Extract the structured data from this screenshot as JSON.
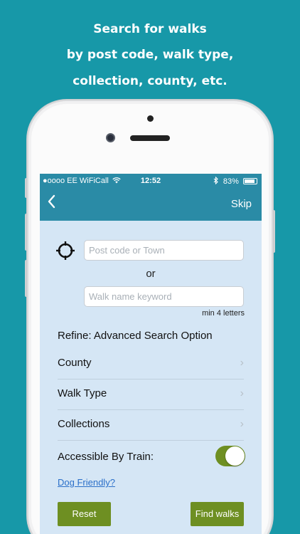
{
  "caption": {
    "line1": "Search for walks",
    "line2": "by post code, walk type,",
    "line3": "collection, county, etc."
  },
  "statusbar": {
    "carrier": "●oooo EE WiFiCall",
    "time": "12:52",
    "battery": "83%",
    "bluetooth_icon": "bluetooth-icon",
    "wifi_icon": "wifi-icon"
  },
  "navbar": {
    "back_icon": "chevron-left-icon",
    "back_glyph": "‹",
    "skip_label": "Skip"
  },
  "search": {
    "location_icon": "crosshair-icon",
    "postcode_placeholder": "Post code or Town",
    "postcode_value": "",
    "or_label": "or",
    "keyword_placeholder": "Walk name keyword",
    "keyword_value": "",
    "min_hint": "min 4 letters"
  },
  "refine": {
    "title": "Refine: Advanced Search Option",
    "rows": [
      {
        "label": "County"
      },
      {
        "label": "Walk Type"
      },
      {
        "label": "Collections"
      }
    ],
    "chevron_glyph": "›"
  },
  "train": {
    "label": "Accessible By Train:",
    "enabled": true
  },
  "dog_link": "Dog Friendly?",
  "buttons": {
    "reset": "Reset",
    "find": "Find walks"
  },
  "colors": {
    "background": "#1798a8",
    "navbar": "#2a8ba6",
    "screen_bg": "#d5e6f5",
    "accent_green": "#6e8f22",
    "link": "#2a6fc9"
  }
}
